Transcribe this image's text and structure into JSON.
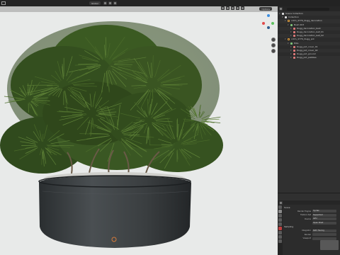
{
  "topbar": {
    "view_mode": "Global",
    "options_label": "Options"
  },
  "viewport": {
    "options_label": "Options"
  },
  "outliner": {
    "title": "Scene Collection",
    "rows": [
      {
        "depth": 0,
        "icon": "coll",
        "label": "Scene Collection"
      },
      {
        "depth": 1,
        "icon": "coll",
        "label": "Collection"
      },
      {
        "depth": 2,
        "icon": "empty",
        "label": "cotm_4776_Dugg_decoration"
      },
      {
        "depth": 3,
        "icon": "green",
        "label": "Bush 003"
      },
      {
        "depth": 4,
        "icon": "mesh",
        "label": "Dugg_decoration_bark"
      },
      {
        "depth": 4,
        "icon": "mesh",
        "label": "Dugg_decoration_leaf_01"
      },
      {
        "depth": 4,
        "icon": "mesh",
        "label": "Dugg_decoration_leaf_02"
      },
      {
        "depth": 2,
        "icon": "empty",
        "label": "cotm_4776_Dugg_pot"
      },
      {
        "depth": 3,
        "icon": "green",
        "label": "Pots"
      },
      {
        "depth": 4,
        "icon": "mesh",
        "label": "Dugg_pot_cover_01"
      },
      {
        "depth": 4,
        "icon": "mesh",
        "label": "Dugg_pot_cover_02"
      },
      {
        "depth": 4,
        "icon": "mesh",
        "label": "Dugg_pot_ground"
      },
      {
        "depth": 4,
        "icon": "mesh",
        "label": "Dugg_pot_pebbles"
      }
    ]
  },
  "properties": {
    "header": "Scene",
    "rows": [
      {
        "kind": "section",
        "label": "Scene"
      },
      {
        "kind": "field",
        "label": "Render Engine",
        "value": "Cycles"
      },
      {
        "kind": "field",
        "label": "Feature Set",
        "value": "Supported"
      },
      {
        "kind": "field",
        "label": "Device",
        "value": "GPU"
      },
      {
        "kind": "field",
        "label": "",
        "value": "Open Shad"
      },
      {
        "kind": "section",
        "label": "Sampling"
      },
      {
        "kind": "field",
        "label": "Integrator",
        "value": "Path Tracing"
      },
      {
        "kind": "field",
        "label": "Render",
        "value": ""
      },
      {
        "kind": "field",
        "label": "Viewport",
        "value": ""
      }
    ]
  }
}
